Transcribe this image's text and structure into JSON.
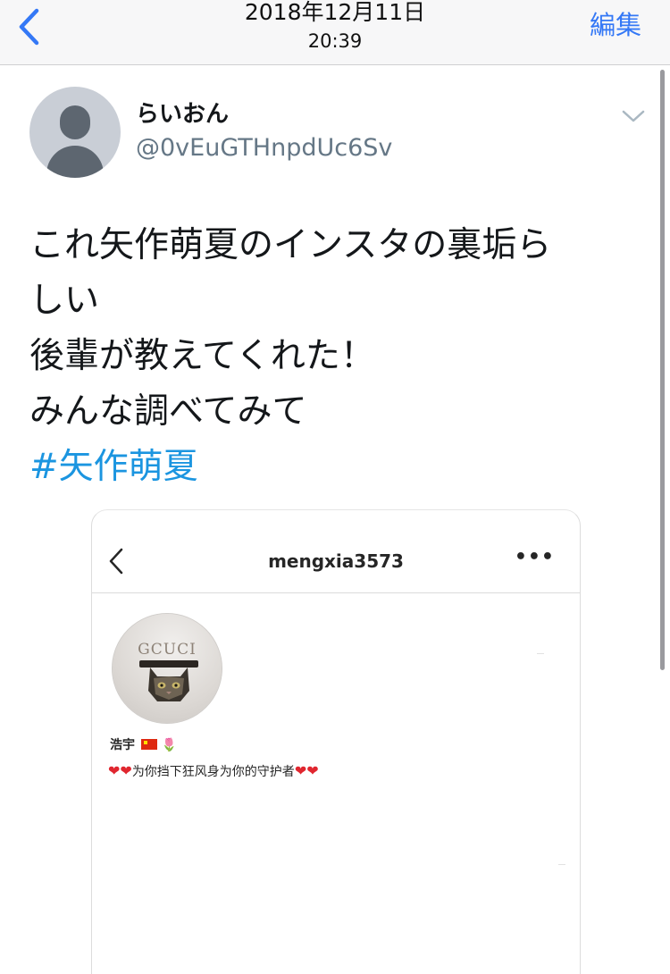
{
  "navbar": {
    "date": "2018年12月11日",
    "time": "20:39",
    "edit_label": "編集",
    "back_icon": "chevron-left-icon",
    "accent_color": "#3478f6"
  },
  "tweet": {
    "display_name": "らいおん",
    "handle": "@0vEuGTHnpdUc6Sv",
    "lines": [
      "これ矢作萌夏のインスタの裏垢ら",
      "しい",
      "後輩が教えてくれた！",
      "みんな調べてみて"
    ],
    "hashtag": "#矢作萌夏",
    "hashtag_color": "#1b95e0"
  },
  "embed": {
    "username": "mengxia3573",
    "more_label": "•••",
    "avatar_brand": "GCUCI",
    "profile_name": "浩宇",
    "profile_emoji": "🌷",
    "bio_text": "为你挡下狂风身为你的守护者"
  }
}
